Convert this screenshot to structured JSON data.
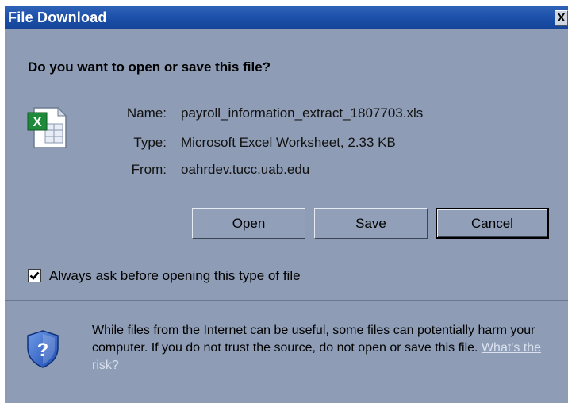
{
  "window": {
    "title": "File Download",
    "close_label": "X"
  },
  "prompt": {
    "question": "Do you want to open or save this file?"
  },
  "file": {
    "icon": "excel-file-icon",
    "name_label": "Name:",
    "name_value": "payroll_information_extract_1807703.xls",
    "type_label": "Type:",
    "type_value": "Microsoft Excel Worksheet, 2.33 KB",
    "from_label": "From:",
    "from_value": "oahrdev.tucc.uab.edu"
  },
  "buttons": {
    "open": "Open",
    "save": "Save",
    "cancel": "Cancel"
  },
  "checkbox": {
    "label": "Always ask before opening this type of file",
    "checked": true
  },
  "warning": {
    "icon": "security-shield-icon",
    "text": "While files from the Internet can be useful, some files can potentially harm your computer. If you do not trust the source, do not open or save this file.",
    "link": "What's the risk?"
  },
  "colors": {
    "dialog_bg": "#8e9db5",
    "titlebar": "#1b4fa8",
    "link": "#d9e1ee"
  }
}
